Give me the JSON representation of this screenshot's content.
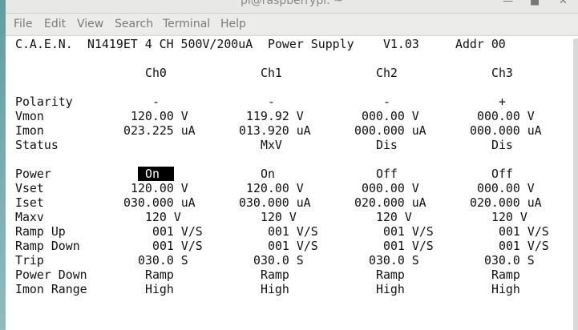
{
  "window": {
    "title": "pi@raspberrypi: ~",
    "controls": [
      "minimize-icon",
      "maximize-icon",
      "close-icon"
    ]
  },
  "menu": [
    "File",
    "Edit",
    "View",
    "Search",
    "Terminal",
    "Help"
  ],
  "header": {
    "brand": "C.A.E.N.",
    "model": "N1419ET 4 CH 500V/200uA",
    "product": "Power Supply",
    "version": "V1.03",
    "address": "Addr 00"
  },
  "channels": [
    "Ch0",
    "Ch1",
    "Ch2",
    "Ch3"
  ],
  "rows": [
    {
      "label": "Polarity",
      "values": [
        "-",
        "-",
        "-",
        "+"
      ]
    },
    {
      "label": "Vmon",
      "values": [
        "120.00 V",
        "119.92 V",
        "000.00 V",
        "000.00 V"
      ]
    },
    {
      "label": "Imon",
      "values": [
        "023.225 uA",
        "013.920 uA",
        "000.000 uA",
        "000.000 uA"
      ]
    },
    {
      "label": "Status",
      "values": [
        "",
        "MxV",
        "Dis",
        "Dis"
      ]
    },
    {
      "label": "Power",
      "values": [
        "On",
        "On",
        "Off",
        "Off"
      ]
    },
    {
      "label": "Vset",
      "values": [
        "120.00 V",
        "120.00 V",
        "000.00 V",
        "000.00 V"
      ]
    },
    {
      "label": "Iset",
      "values": [
        "030.000 uA",
        "030.000 uA",
        "020.000 uA",
        "020.000 uA"
      ]
    },
    {
      "label": "Maxv",
      "values": [
        "120 V",
        "120 V",
        "120 V",
        "120 V"
      ]
    },
    {
      "label": "Ramp Up",
      "values": [
        "001 V/S",
        "001 V/S",
        "001 V/S",
        "001 V/S"
      ]
    },
    {
      "label": "Ramp Down",
      "values": [
        "001 V/S",
        "001 V/S",
        "001 V/S",
        "001 V/S"
      ]
    },
    {
      "label": "Trip",
      "values": [
        "030.0 S",
        "030.0 S",
        "030.0 S",
        "030.0 S"
      ]
    },
    {
      "label": "Power Down",
      "values": [
        "Ramp",
        "Ramp",
        "Ramp",
        "Ramp"
      ]
    },
    {
      "label": "Imon Range",
      "values": [
        "High",
        "High",
        "High",
        "High"
      ]
    }
  ],
  "selected": {
    "row": 4,
    "channel": 0
  }
}
